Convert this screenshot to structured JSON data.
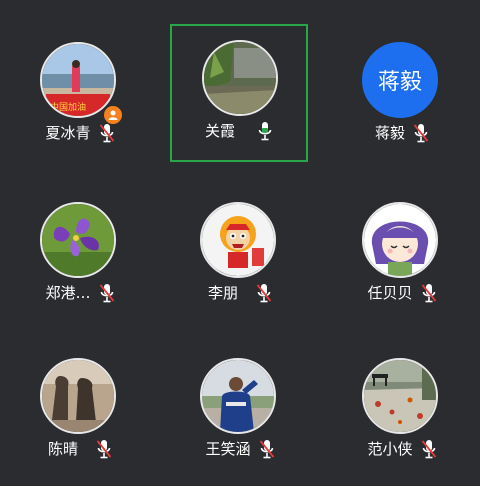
{
  "participants": [
    {
      "name": "夏冰青",
      "mic": "muted",
      "host": true
    },
    {
      "name": "关霞",
      "mic": "on",
      "speaking": true
    },
    {
      "name": "蒋毅",
      "mic": "muted",
      "avatar_text": "蒋毅"
    },
    {
      "name": "郑港…",
      "mic": "muted"
    },
    {
      "name": "李朋",
      "mic": "muted"
    },
    {
      "name": "任贝贝",
      "mic": "muted"
    },
    {
      "name": "陈晴",
      "mic": "muted"
    },
    {
      "name": "王笑涵",
      "mic": "muted"
    },
    {
      "name": "范小侠",
      "mic": "muted"
    }
  ],
  "colors": {
    "background": "#2b2c30",
    "speaking_border": "#2aa64a",
    "text_avatar_bg": "#1e6ff0",
    "host_badge": "#f5821f",
    "mic_muted_slash": "#e23b3b"
  }
}
